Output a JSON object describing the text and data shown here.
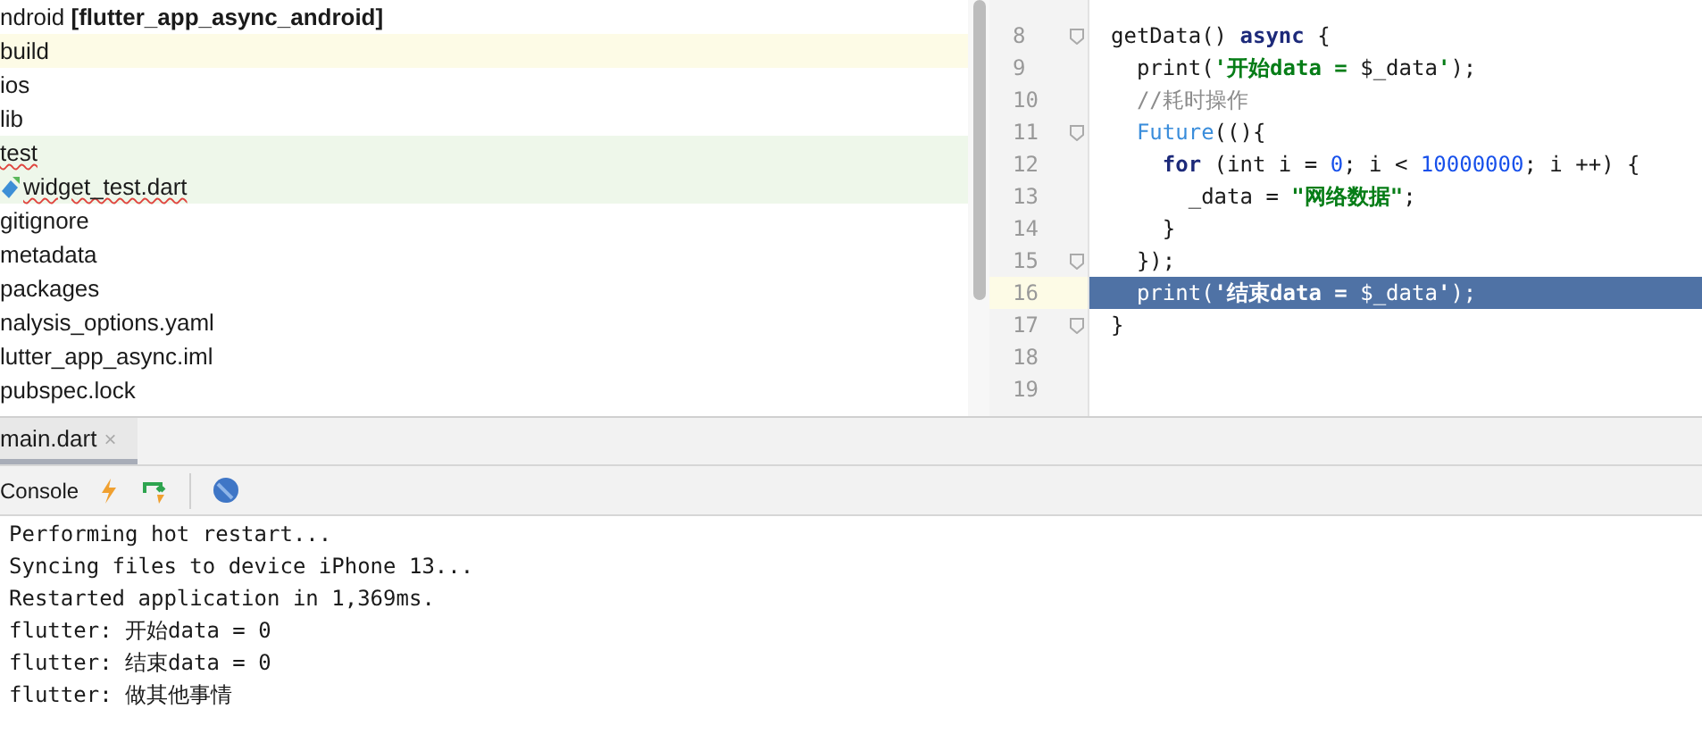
{
  "project_tree": {
    "root": {
      "name": "ndroid",
      "module": "**[flutter_app_async_android]**"
    },
    "items": [
      {
        "name": "build",
        "color": "#fdfbe6"
      },
      {
        "name": "ios"
      },
      {
        "name": "lib"
      },
      {
        "name": "test",
        "color": "#eef7ea",
        "misspelled": true,
        "children": [
          {
            "name": "widget_test.dart",
            "misspelled": true,
            "color": "#eef7ea"
          }
        ]
      },
      {
        "name": "gitignore"
      },
      {
        "name": "metadata"
      },
      {
        "name": "packages"
      },
      {
        "name": "nalysis_options.yaml"
      },
      {
        "name": "lutter_app_async.iml"
      },
      {
        "name": "pubspec.lock"
      }
    ]
  },
  "editor": {
    "lines": [
      {
        "number": "8",
        "fold": true,
        "selected": false,
        "tokens": [
          {
            "kind": "plain",
            "text": "getData() "
          },
          {
            "kind": "keyword",
            "text": "async"
          },
          {
            "kind": "plain",
            "text": " {"
          }
        ]
      },
      {
        "number": "9",
        "fold": false,
        "selected": false,
        "tokens": [
          {
            "kind": "plain",
            "text": "  print("
          },
          {
            "kind": "string",
            "text": "'开始data = "
          },
          {
            "kind": "plain",
            "text": "$_data"
          },
          {
            "kind": "string",
            "text": "'"
          },
          {
            "kind": "plain",
            "text": ");"
          }
        ]
      },
      {
        "number": "10",
        "fold": false,
        "selected": false,
        "tokens": [
          {
            "kind": "comment",
            "text": "  //耗时操作"
          }
        ]
      },
      {
        "number": "11",
        "fold": true,
        "selected": false,
        "tokens": [
          {
            "kind": "call",
            "text": "  Future"
          },
          {
            "kind": "plain",
            "text": "((){"
          }
        ]
      },
      {
        "number": "12",
        "fold": false,
        "selected": false,
        "tokens": [
          {
            "kind": "keyword",
            "text": "    for"
          },
          {
            "kind": "plain",
            "text": " (int i = "
          },
          {
            "kind": "number",
            "text": "0"
          },
          {
            "kind": "plain",
            "text": "; i < "
          },
          {
            "kind": "number",
            "text": "10000000"
          },
          {
            "kind": "plain",
            "text": "; i ++) {"
          }
        ]
      },
      {
        "number": "13",
        "fold": false,
        "selected": false,
        "tokens": [
          {
            "kind": "plain",
            "text": "      _data = "
          },
          {
            "kind": "string",
            "text": "\"网络数据\""
          },
          {
            "kind": "plain",
            "text": ";"
          }
        ]
      },
      {
        "number": "14",
        "fold": false,
        "selected": false,
        "tokens": [
          {
            "kind": "plain",
            "text": "    }"
          }
        ]
      },
      {
        "number": "15",
        "fold": true,
        "selected": false,
        "tokens": [
          {
            "kind": "plain",
            "text": "  });"
          }
        ]
      },
      {
        "number": "16",
        "fold": false,
        "selected": true,
        "tokens": [
          {
            "kind": "plain",
            "text": "  print("
          },
          {
            "kind": "string",
            "text": "'结束data = "
          },
          {
            "kind": "plain",
            "text": "$_data"
          },
          {
            "kind": "string",
            "text": "'"
          },
          {
            "kind": "plain",
            "text": ");"
          }
        ]
      },
      {
        "number": "17",
        "fold": true,
        "selected": false,
        "tokens": [
          {
            "kind": "plain",
            "text": "}"
          }
        ]
      },
      {
        "number": "18",
        "fold": false,
        "selected": false
      },
      {
        "number": "19",
        "fold": false,
        "selected": false
      }
    ]
  },
  "run_panel": {
    "tabs": [
      {
        "label": "main.dart",
        "close": "×",
        "selected": true
      }
    ],
    "toolbar": {
      "label": "Console"
    },
    "console": [
      "Performing hot restart...",
      "Syncing files to device iPhone 13...",
      "Restarted application in 1,369ms.",
      "flutter: 开始data = 0",
      "flutter: 结束data = 0",
      "flutter: 做其他事情"
    ]
  }
}
